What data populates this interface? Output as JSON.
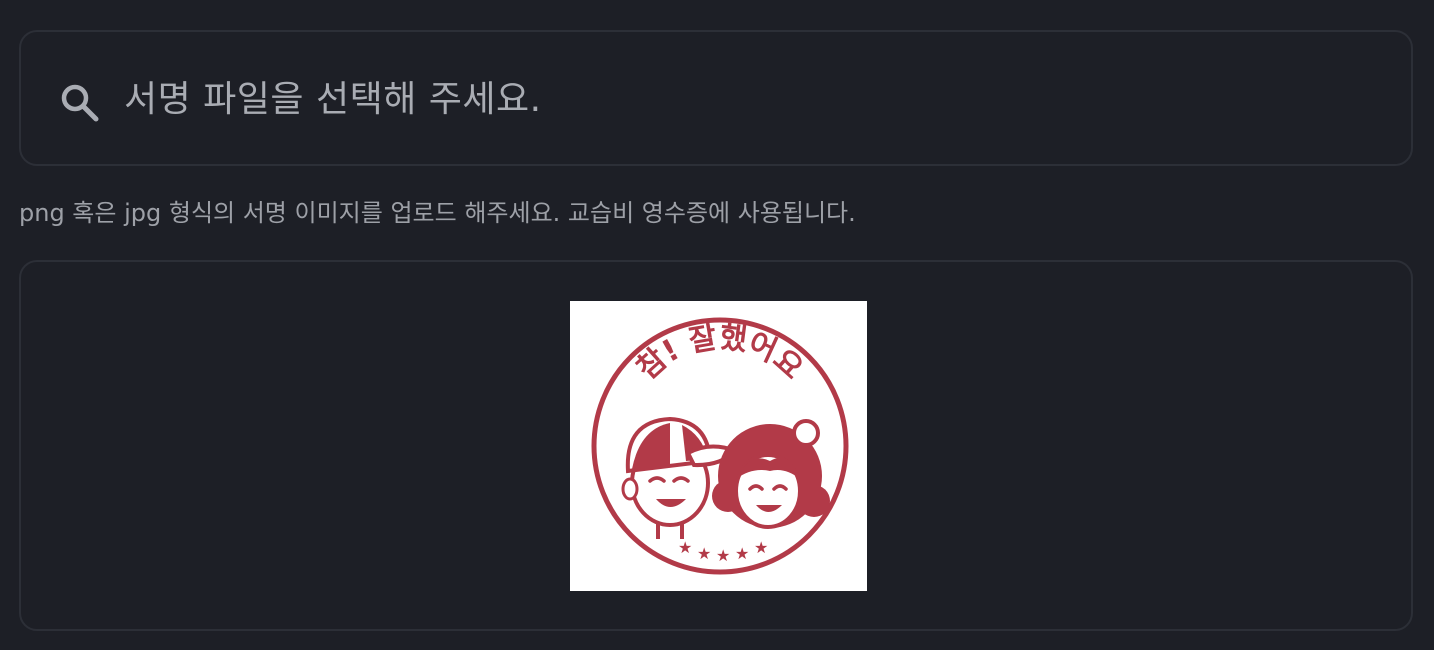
{
  "file_picker": {
    "icon": "search-icon",
    "placeholder": "서명 파일을 선택해 주세요."
  },
  "helper_text": "png 혹은 jpg 형식의 서명 이미지를 업로드 해주세요. 교습비 영수증에 사용됩니다.",
  "preview": {
    "stamp_text": "참! 잘했어요",
    "stamp_color": "#b23a48"
  }
}
